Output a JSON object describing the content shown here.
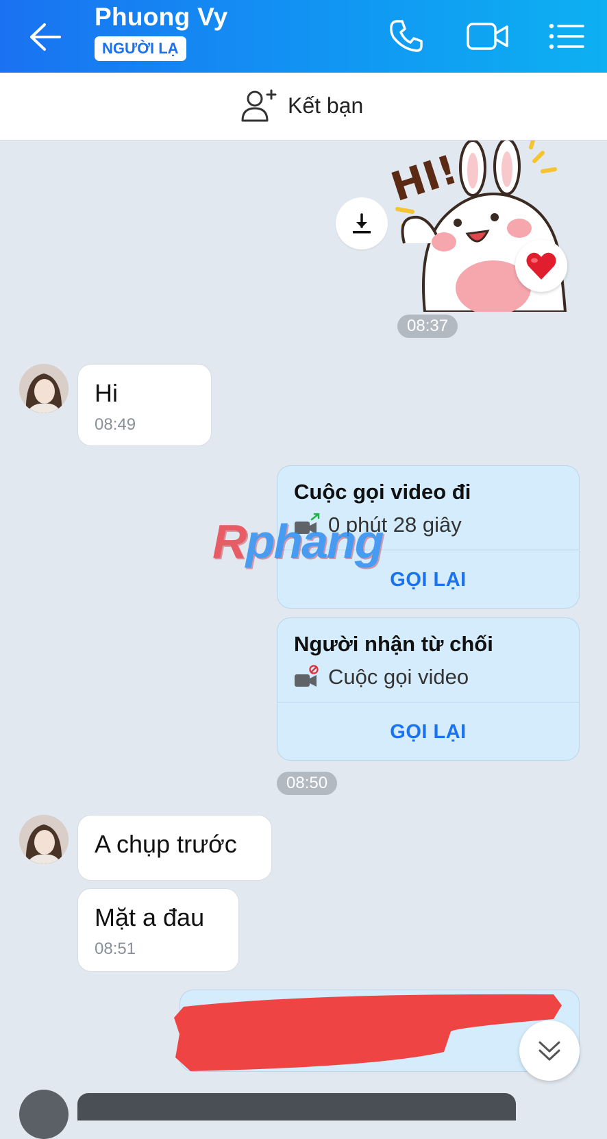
{
  "header": {
    "contact_name": "Phuong Vy",
    "badge": "NGƯỜI LẠ",
    "icons": [
      "back-arrow-icon",
      "phone-icon",
      "video-call-icon",
      "menu-list-icon"
    ]
  },
  "friend_bar": {
    "label": "Kết bạn",
    "icon": "add-friend-icon"
  },
  "messages": {
    "sticker_time": "08:37",
    "hi_text": "Hi",
    "hi_time": "08:49",
    "call1": {
      "title": "Cuộc gọi video đi",
      "detail": "0 phút 28 giây",
      "action": "GỌI LẠI"
    },
    "call2": {
      "title": "Người nhận từ chối",
      "detail": "Cuộc gọi video",
      "action": "GỌI LẠI"
    },
    "calls_time": "08:50",
    "msg_a": "A chụp trước",
    "msg_b": "Mặt a đau",
    "msg_b_time": "08:51"
  },
  "watermark": {
    "part1": "R",
    "part2": "phang"
  },
  "colors": {
    "header_start": "#1a72f2",
    "header_end": "#0db0f2",
    "chat_bg": "#e2e8ef",
    "outgoing_bubble": "#d4ecfb",
    "accent": "#1a72f2",
    "redaction": "#ee4444"
  }
}
